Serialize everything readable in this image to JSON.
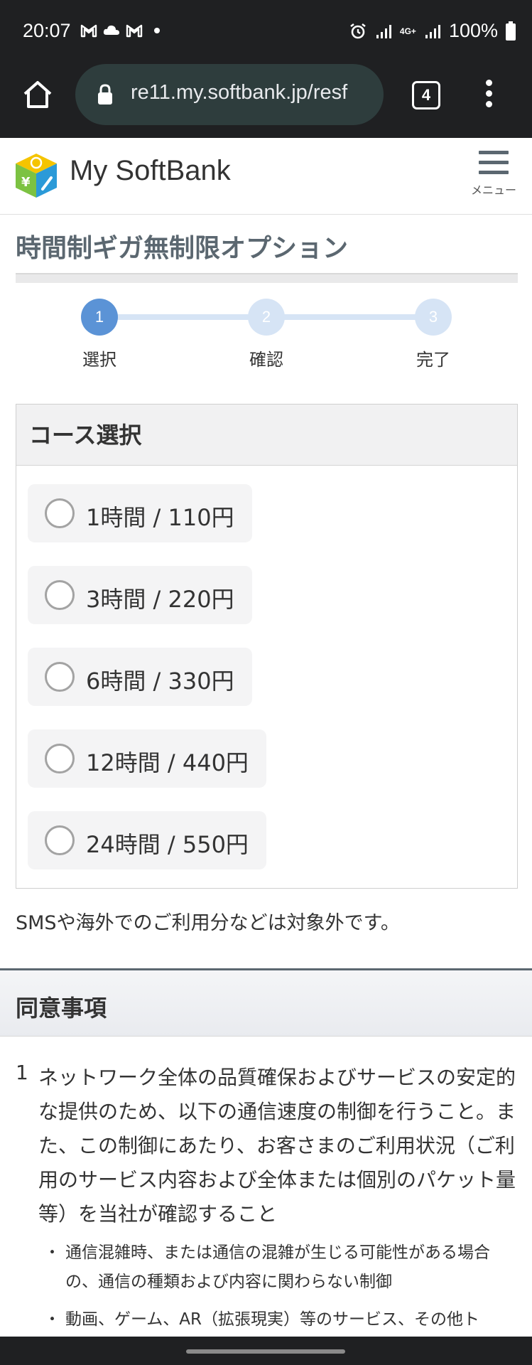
{
  "status_bar": {
    "time": "20:07",
    "battery": "100%",
    "network": "4G+",
    "left_icons": [
      "gmail-icon",
      "cloud-icon",
      "gmail-icon",
      "dot-icon"
    ],
    "right_icons": [
      "alarm-icon",
      "signal-icon",
      "signal-icon",
      "battery-icon"
    ]
  },
  "browser": {
    "url": "re11.my.softbank.jp/resf",
    "tab_count": "4"
  },
  "header": {
    "logo_text": "My SoftBank",
    "menu_label": "メニュー"
  },
  "page": {
    "title": "時間制ギガ無制限オプション"
  },
  "stepper": {
    "steps": [
      {
        "number": "1",
        "label": "選択",
        "active": true
      },
      {
        "number": "2",
        "label": "確認",
        "active": false
      },
      {
        "number": "3",
        "label": "完了",
        "active": false
      }
    ],
    "colors": {
      "active": "#5b93d6",
      "inactive": "#d6e4f5"
    }
  },
  "course": {
    "heading": "コース選択",
    "options": [
      {
        "label": "1時間 / 110円",
        "selected": false
      },
      {
        "label": "3時間 / 220円",
        "selected": false
      },
      {
        "label": "6時間 / 330円",
        "selected": false
      },
      {
        "label": "12時間 / 440円",
        "selected": false
      },
      {
        "label": "24時間 / 550円",
        "selected": false
      }
    ],
    "note": "SMSや海外でのご利用分などは対象外です。"
  },
  "agreement": {
    "heading": "同意事項",
    "items": [
      {
        "number": "1",
        "text": "ネットワーク全体の品質確保およびサービスの安定的な提供のため、以下の通信速度の制御を行うこと。また、この制御にあたり、お客さまのご利用状況（ご利用のサービス内容および全体または個別のパケット量等）を当社が確認すること",
        "bullets": [
          "通信混雑時、または通信の混雑が生じる可能性がある場合の、通信の種類および内容に関わらない制御",
          "動画、ゲーム、AR（拡張現実）等のサービス、その他ト"
        ]
      }
    ]
  }
}
